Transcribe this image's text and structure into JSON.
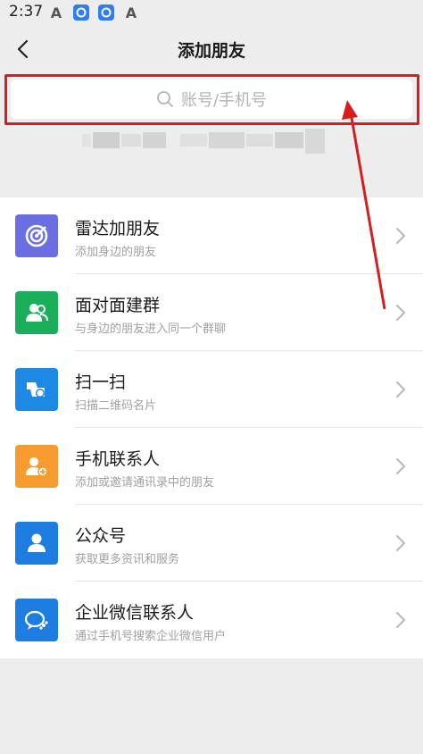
{
  "status": {
    "time": "2:37"
  },
  "header": {
    "title": "添加朋友"
  },
  "search": {
    "placeholder": "账号/手机号"
  },
  "colors": {
    "annotation": "#d91c1c",
    "radar": "#6b6ee0",
    "group": "#1aad5a",
    "scan": "#1e88e5",
    "contacts": "#f59b30",
    "official": "#1e7de0",
    "enterprise": "#1e7de0"
  },
  "list": {
    "items": [
      {
        "label": "雷达加朋友",
        "sub": "添加身边的朋友",
        "icon": "radar-icon"
      },
      {
        "label": "面对面建群",
        "sub": "与身边的朋友进入同一个群聊",
        "icon": "group-icon"
      },
      {
        "label": "扫一扫",
        "sub": "扫描二维码名片",
        "icon": "scan-icon"
      },
      {
        "label": "手机联系人",
        "sub": "添加或邀请通讯录中的朋友",
        "icon": "phone-contact-icon"
      },
      {
        "label": "公众号",
        "sub": "获取更多资讯和服务",
        "icon": "official-account-icon"
      },
      {
        "label": "企业微信联系人",
        "sub": "通过手机号搜索企业微信用户",
        "icon": "enterprise-wechat-icon"
      }
    ]
  }
}
